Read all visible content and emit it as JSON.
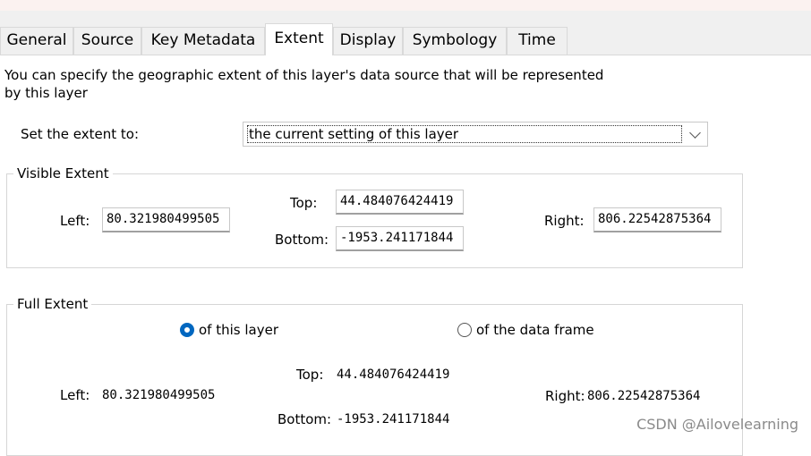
{
  "tabs": [
    {
      "label": "General"
    },
    {
      "label": "Source"
    },
    {
      "label": "Key Metadata"
    },
    {
      "label": "Extent",
      "active": true
    },
    {
      "label": "Display"
    },
    {
      "label": "Symbology"
    },
    {
      "label": "Time"
    }
  ],
  "description": "You can specify the geographic extent of this layer's data source that will be represented by this layer",
  "set_extent": {
    "label": "Set the extent to:",
    "value": "the current setting of this layer"
  },
  "visible_extent": {
    "title": "Visible Extent",
    "top_label": "Top:",
    "top_value": "44.484076424419",
    "left_label": "Left:",
    "left_value": "80.321980499505",
    "right_label": "Right:",
    "right_value": "806.22542875364",
    "bottom_label": "Bottom:",
    "bottom_value": "-1953.241171844"
  },
  "full_extent": {
    "title": "Full Extent",
    "option_layer": "of this layer",
    "option_frame": "of the data frame",
    "selected": "of this layer",
    "top_label": "Top:",
    "top_value": "44.484076424419",
    "left_label": "Left:",
    "left_value": "80.321980499505",
    "right_label": "Right:",
    "right_value": "806.22542875364",
    "bottom_label": "Bottom:",
    "bottom_value": "-1953.241171844"
  },
  "watermark": "CSDN @Ailovelearning",
  "colors": {
    "accent": "#0067c0",
    "tab_bg": "#f0f0f0",
    "border": "#d6d6d6"
  }
}
